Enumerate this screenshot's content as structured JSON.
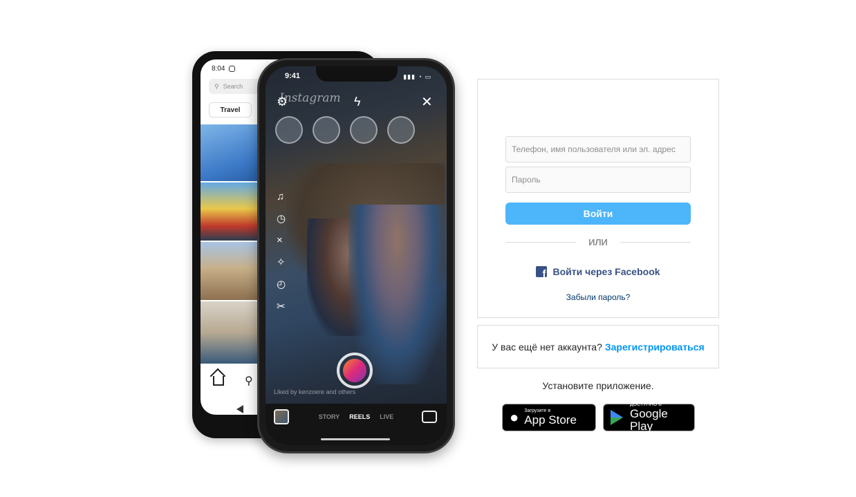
{
  "mockup": {
    "back_phone": {
      "time": "8:04",
      "search_placeholder": "Search",
      "chip": "Travel"
    },
    "front_phone": {
      "time": "9:41",
      "logo": "Instagram",
      "caption": "Liked by kenzoere and others",
      "modes": [
        "STORY",
        "REELS",
        "LIVE"
      ]
    }
  },
  "login": {
    "username_placeholder": "Телефон, имя пользователя или эл. адрес",
    "password_placeholder": "Пароль",
    "login_button": "Войти",
    "or_text": "ИЛИ",
    "facebook_login": "Войти через Facebook",
    "forgot_password": "Забыли пароль?"
  },
  "signup": {
    "prompt": "У вас ещё нет аккаунта?",
    "link": "Зарегистрироваться"
  },
  "get_app": {
    "title": "Установите приложение.",
    "app_store_small": "Загрузите в",
    "app_store_big": "App Store",
    "google_play_small": "ДОСТУПНО В",
    "google_play_big": "Google Play"
  },
  "colors": {
    "login_button": "#4db5f9",
    "link": "#0095f6",
    "facebook": "#385185",
    "border": "#dbdbdb"
  },
  "icons": [
    "instagram-icon",
    "search-icon",
    "home-icon",
    "gear-icon",
    "flash-off-icon",
    "close-icon",
    "music-icon",
    "timer-icon",
    "facebook-icon",
    "apple-icon",
    "google-play-icon"
  ]
}
